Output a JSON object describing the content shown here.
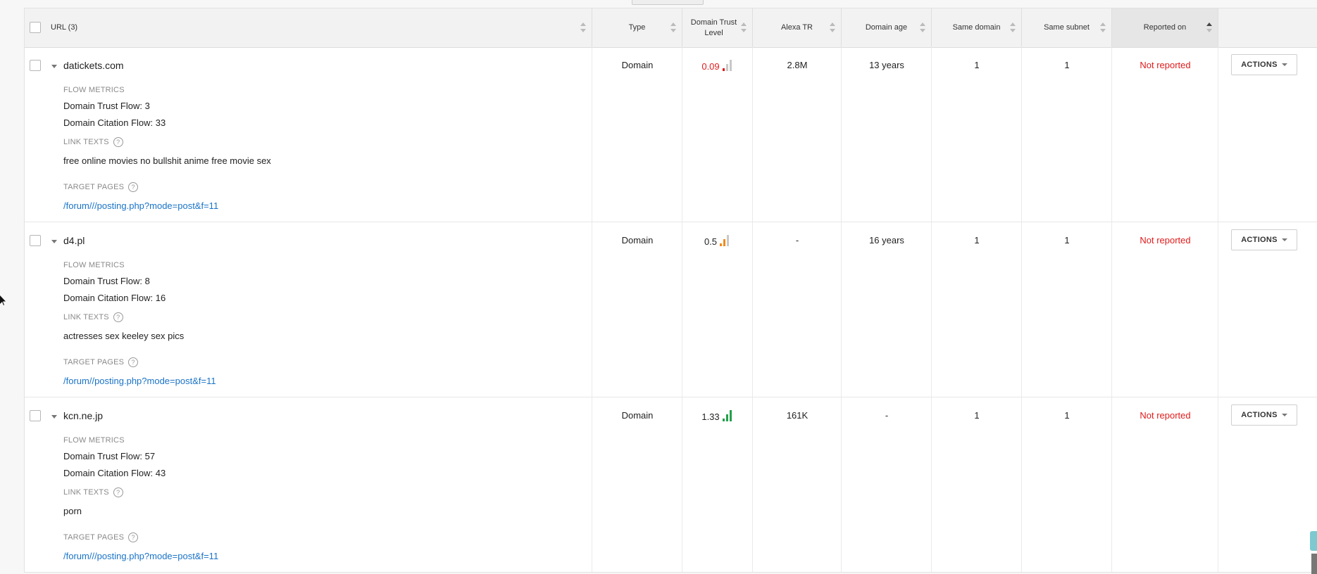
{
  "header": {
    "url_label": "URL (3)",
    "type": "Type",
    "trust_level": "Domain Trust Level",
    "alexa": "Alexa TR",
    "age": "Domain age",
    "same_domain": "Same domain",
    "same_subnet": "Same subnet",
    "reported_on": "Reported on"
  },
  "rows": [
    {
      "domain": "datickets.com",
      "type": "Domain",
      "trust": "0.09",
      "trust_color": "#e01b1b",
      "alexa": "2.8M",
      "age": "13 years",
      "same_domain": "1",
      "same_subnet": "1",
      "reported": "Not reported",
      "actions": "ACTIONS",
      "flow_label": "FLOW METRICS",
      "trust_flow": "Domain Trust Flow: 3",
      "citation_flow": "Domain Citation Flow: 33",
      "link_label": "LINK TEXTS",
      "link_text": "free online movies no bullshit anime free movie sex",
      "target_label": "TARGET PAGES",
      "target": "/forum///posting.php?mode=post&f=11"
    },
    {
      "domain": "d4.pl",
      "type": "Domain",
      "trust": "0.5",
      "trust_color": "#222222",
      "alexa": "-",
      "age": "16 years",
      "same_domain": "1",
      "same_subnet": "1",
      "reported": "Not reported",
      "actions": "ACTIONS",
      "flow_label": "FLOW METRICS",
      "trust_flow": "Domain Trust Flow: 8",
      "citation_flow": "Domain Citation Flow: 16",
      "link_label": "LINK TEXTS",
      "link_text": "actresses sex keeley sex pics",
      "target_label": "TARGET PAGES",
      "target": "/forum//posting.php?mode=post&f=11"
    },
    {
      "domain": "kcn.ne.jp",
      "type": "Domain",
      "trust": "1.33",
      "trust_color": "#222222",
      "alexa": "161K",
      "age": "-",
      "same_domain": "1",
      "same_subnet": "1",
      "reported": "Not reported",
      "actions": "ACTIONS",
      "flow_label": "FLOW METRICS",
      "trust_flow": "Domain Trust Flow: 57",
      "citation_flow": "Domain Citation Flow: 43",
      "link_label": "LINK TEXTS",
      "link_text": "porn",
      "target_label": "TARGET PAGES",
      "target": "/forum///posting.php?mode=post&f=11"
    }
  ],
  "help_glyph": "?",
  "colors": {
    "link": "#1a73c7",
    "not_reported": "#e01b1b",
    "bar_red": "#e01b1b",
    "bar_orange": "#f08a1c",
    "bar_green": "#23a04a",
    "bar_gray": "#c8c8c8"
  }
}
